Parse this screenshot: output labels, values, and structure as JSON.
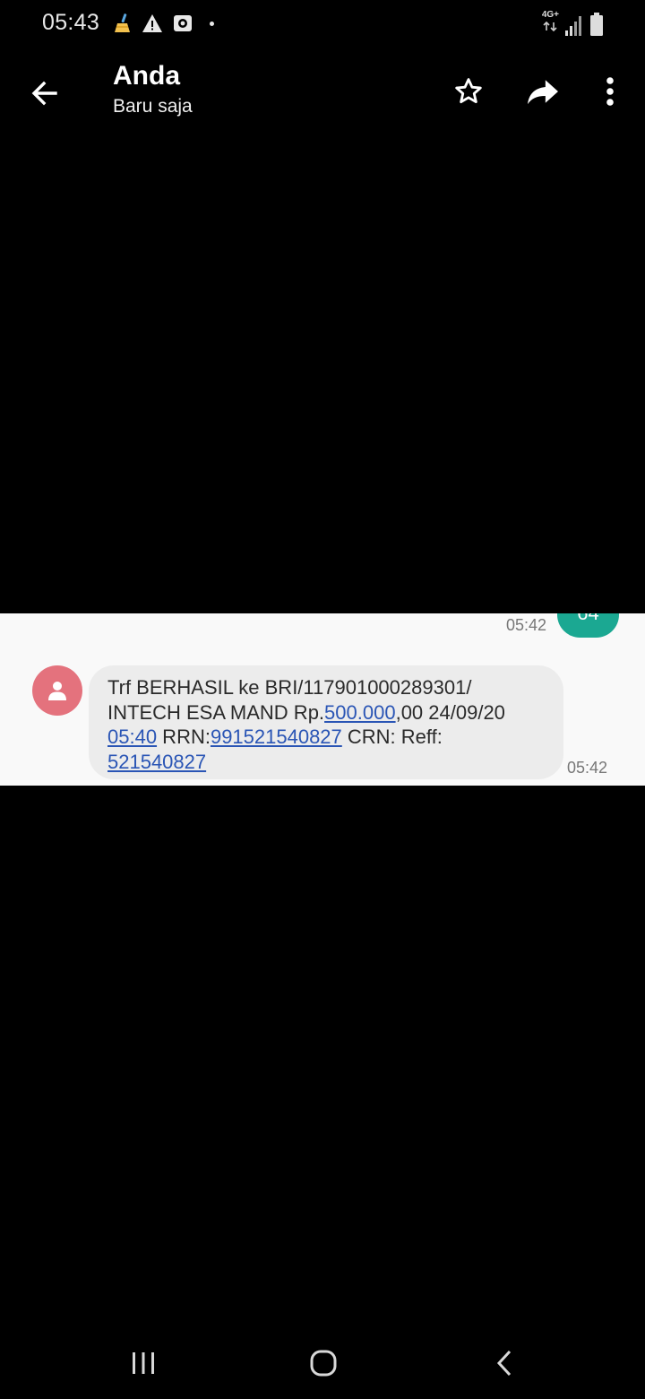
{
  "status_bar": {
    "time": "05:43",
    "network_label": "4G+",
    "icons": [
      "cleaner-app-icon",
      "warning-icon",
      "screen-record-icon",
      "notification-dot",
      "signal-icon",
      "battery-icon"
    ]
  },
  "app_bar": {
    "contact_name": "Anda",
    "subtitle": "Baru saja",
    "icons": [
      "back-arrow-icon",
      "star-icon",
      "forward-icon",
      "more-vert-icon"
    ]
  },
  "conversation": {
    "previous_message": {
      "time": "05:42",
      "text_partial": "64",
      "bubble_color": "#1ba892"
    },
    "message": {
      "avatar_color": "#e4727d",
      "text_parts": [
        "Trf BERHASIL ke BRI/117901000289301/ INTECH ESA MAND Rp.",
        "500.000",
        ",00 24/09/20 ",
        "05:40",
        " RRN:",
        "991521540827",
        " CRN: Reff: ",
        "521540827"
      ],
      "time": "05:42",
      "link_color": "#2a55b5"
    }
  },
  "nav_bar": {
    "icons": [
      "recent-apps-icon",
      "home-icon",
      "back-icon"
    ]
  }
}
